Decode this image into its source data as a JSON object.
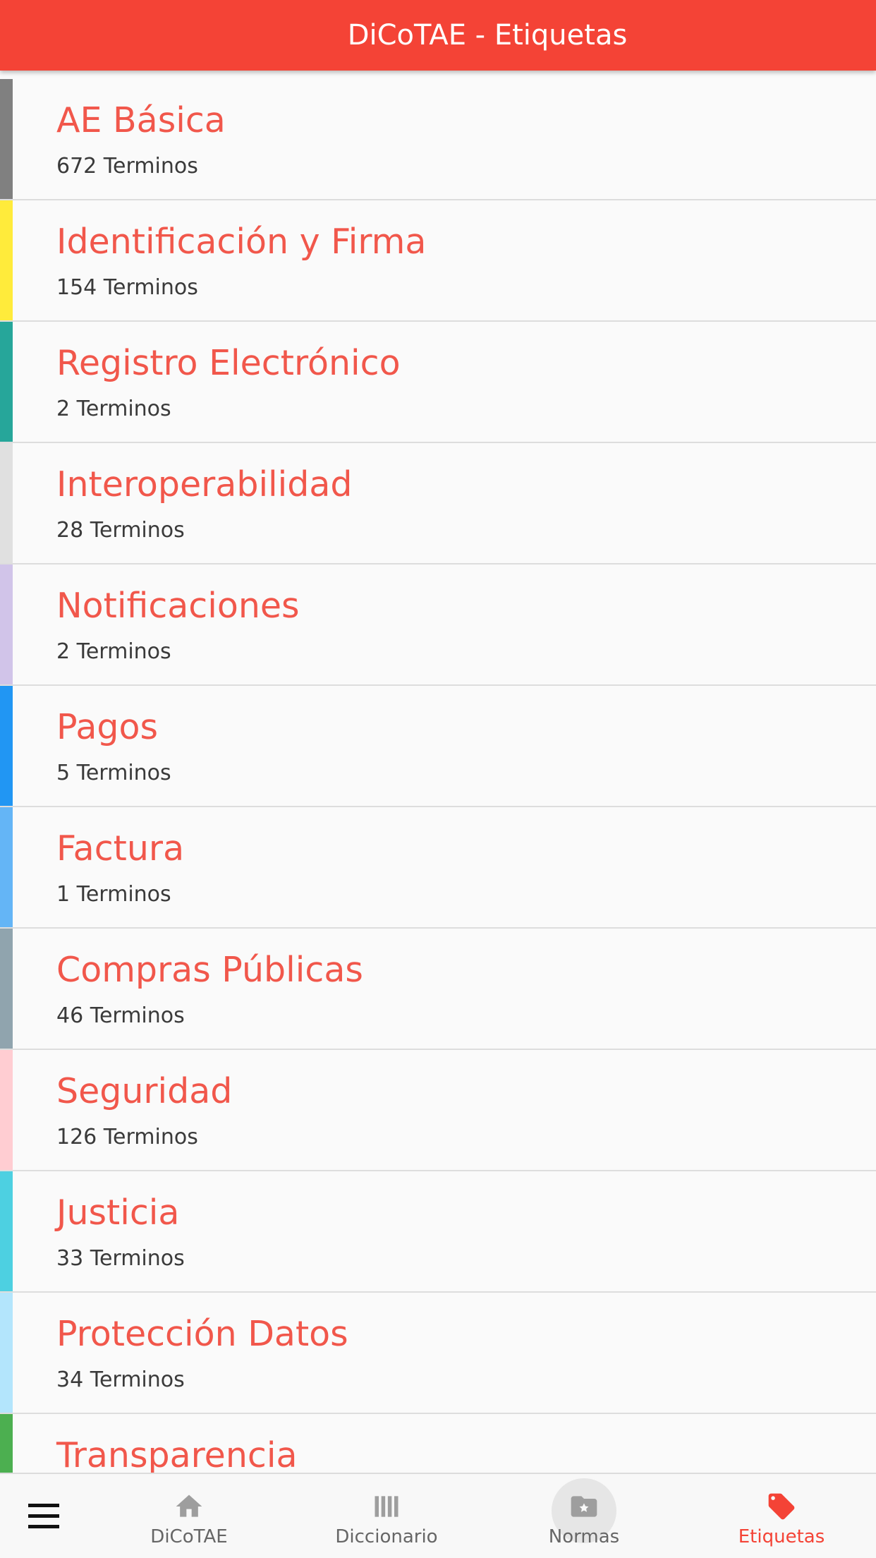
{
  "header": {
    "title": "DiCoTAE - Etiquetas"
  },
  "items": [
    {
      "title": "AE Básica",
      "count": "672 Terminos",
      "color": "#808080"
    },
    {
      "title": "Identificación y Firma",
      "count": "154 Terminos",
      "color": "#ffeb3b"
    },
    {
      "title": "Registro Electrónico",
      "count": "2 Terminos",
      "color": "#26a69a"
    },
    {
      "title": "Interoperabilidad",
      "count": "28 Terminos",
      "color": "#e0e0e0"
    },
    {
      "title": "Notificaciones",
      "count": "2 Terminos",
      "color": "#d1c4e9"
    },
    {
      "title": "Pagos",
      "count": "5 Terminos",
      "color": "#2196f3"
    },
    {
      "title": "Factura",
      "count": "1 Terminos",
      "color": "#64b5f6"
    },
    {
      "title": "Compras Públicas",
      "count": "46 Terminos",
      "color": "#90a4ae"
    },
    {
      "title": "Seguridad",
      "count": "126 Terminos",
      "color": "#ffcdd2"
    },
    {
      "title": "Justicia",
      "count": "33 Terminos",
      "color": "#4dd0e1"
    },
    {
      "title": "Protección Datos",
      "count": "34 Terminos",
      "color": "#b3e5fc"
    },
    {
      "title": "Transparencia",
      "count": "",
      "color": "#4caf50"
    }
  ],
  "tabbar": {
    "menu_icon": "hamburger-menu-icon",
    "tabs": [
      {
        "label": "DiCoTAE",
        "icon": "home-icon",
        "active": false
      },
      {
        "label": "Diccionario",
        "icon": "book-icon",
        "active": false
      },
      {
        "label": "Normas",
        "icon": "folder-star-icon",
        "active": false
      },
      {
        "label": "Etiquetas",
        "icon": "tag-icon",
        "active": true
      }
    ]
  },
  "colors": {
    "accent": "#f44336",
    "title_text": "#f1574b",
    "inactive_tab": "#9e9e9e"
  }
}
